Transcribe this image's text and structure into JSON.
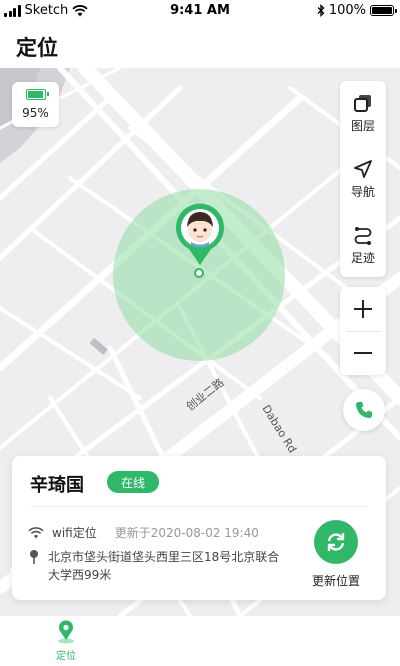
{
  "status_bar": {
    "carrier": "Sketch",
    "time": "9:41 AM",
    "battery": "100%"
  },
  "header": {
    "title": "定位"
  },
  "map": {
    "battery_level": "95%",
    "tools": [
      {
        "label": "图层",
        "icon": "layers-icon"
      },
      {
        "label": "导航",
        "icon": "navigation-icon"
      },
      {
        "label": "足迹",
        "icon": "route-icon"
      }
    ],
    "road_labels": [
      "创业二路",
      "Dabao Rd"
    ],
    "accent_color": "#2fb867"
  },
  "info": {
    "name": "辛琦国",
    "status": "在线",
    "location_type": "wifi定位",
    "update_time": "更新于2020-08-02 19:40",
    "address": "北京市垡头街道垡头西里三区18号北京联合大学西99米",
    "refresh_label": "更新位置"
  },
  "tab_bar": {
    "tabs": [
      {
        "label": "定位",
        "icon": "location-pin-icon",
        "active": true
      }
    ]
  }
}
